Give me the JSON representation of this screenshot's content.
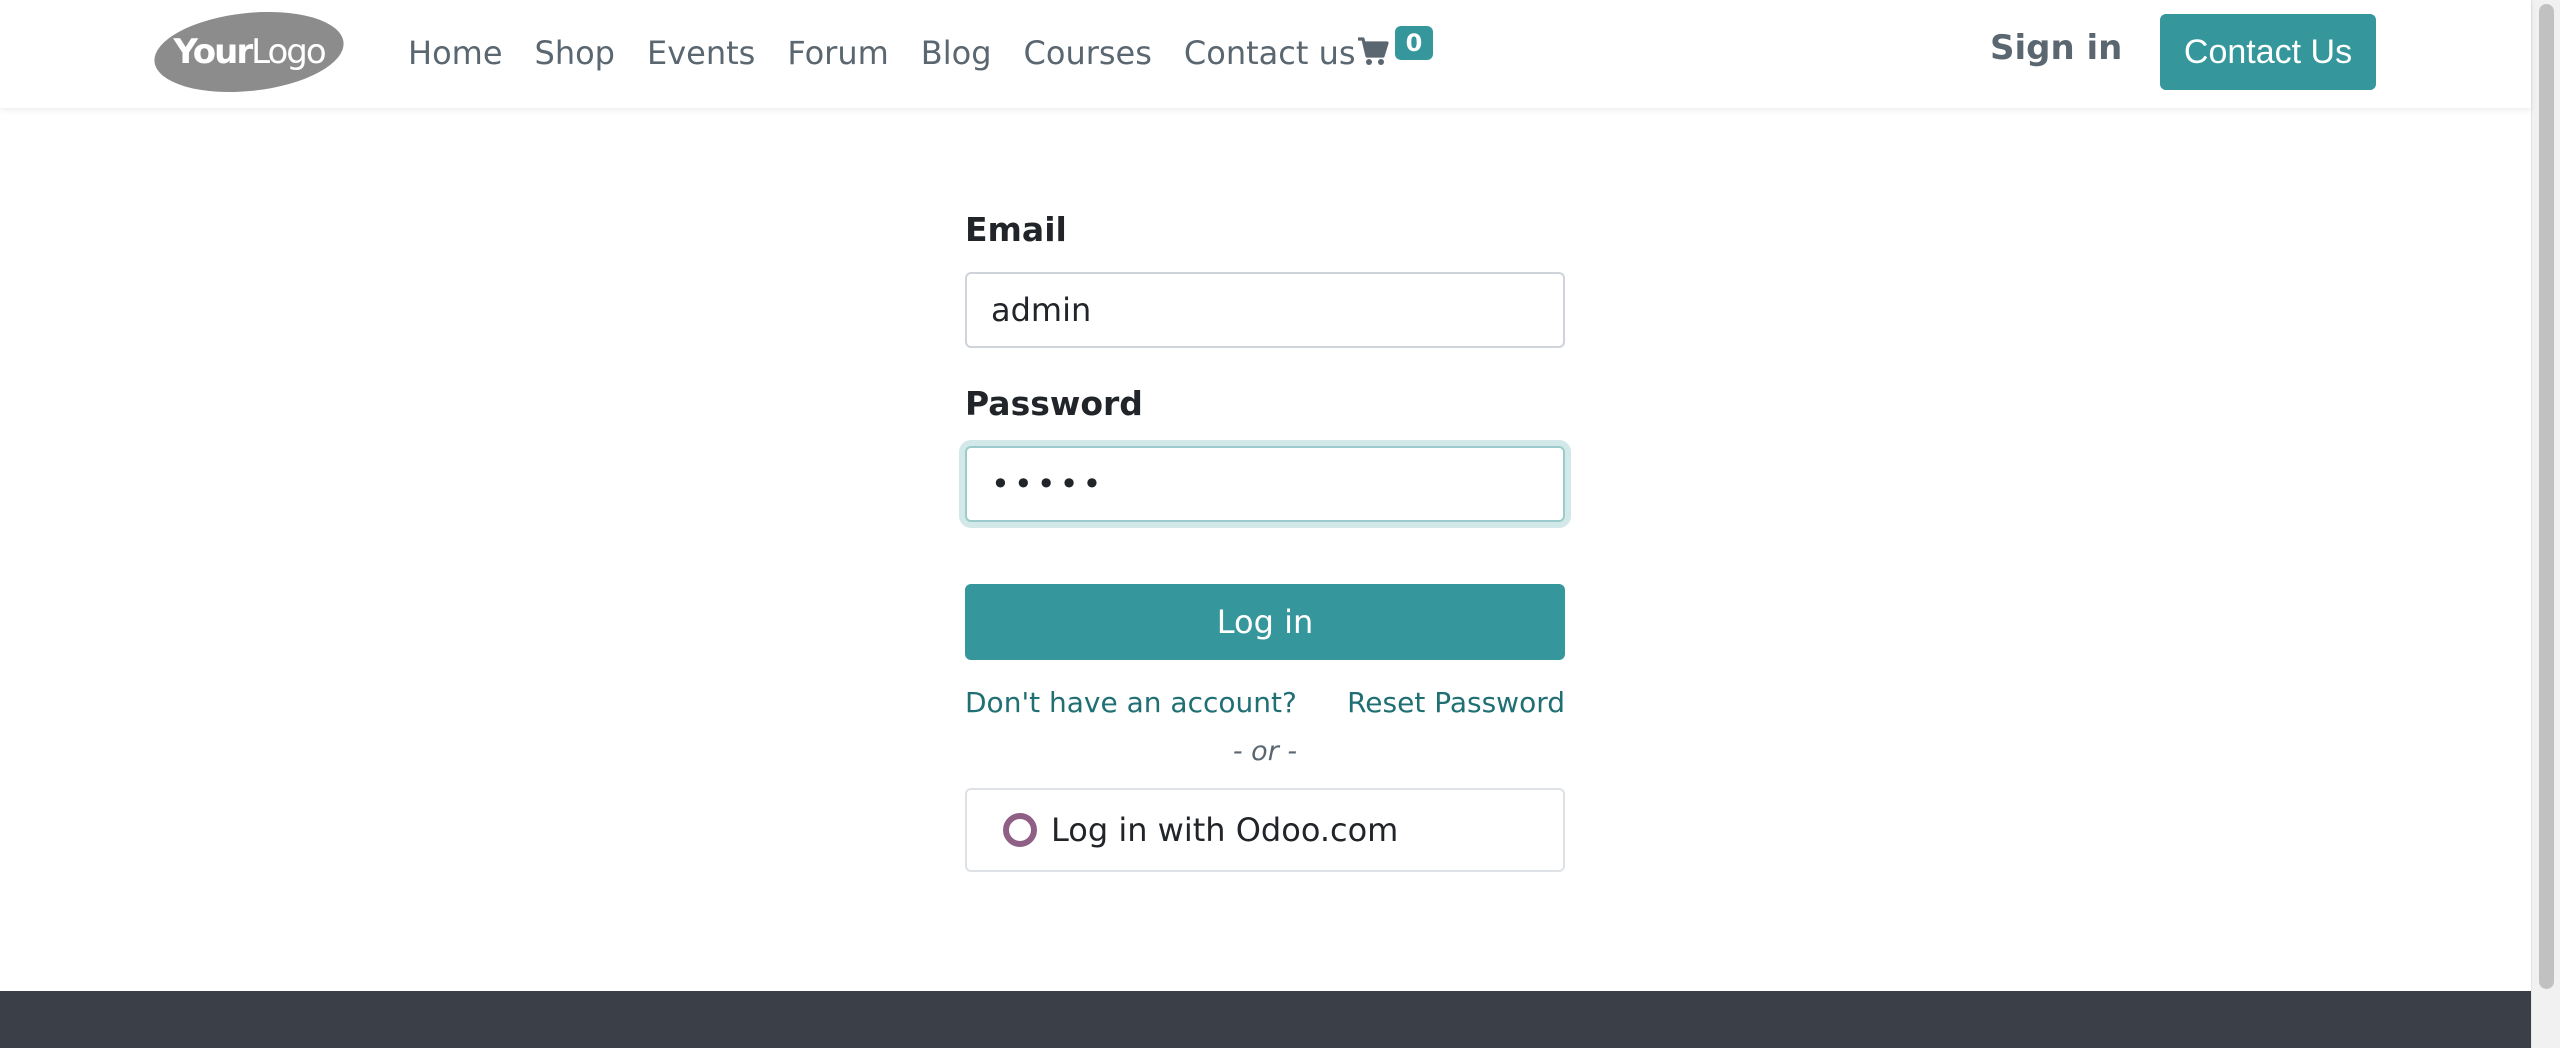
{
  "header": {
    "logo_text": "YourLogo",
    "nav": [
      "Home",
      "Shop",
      "Events",
      "Forum",
      "Blog",
      "Courses",
      "Contact us"
    ],
    "cart_count": "0",
    "sign_in": "Sign in",
    "contact_button": "Contact Us"
  },
  "form": {
    "email_label": "Email",
    "email_value": "admin",
    "password_label": "Password",
    "password_value": "•••••",
    "login_button": "Log in",
    "signup_link": "Don't have an account?",
    "reset_link": "Reset Password",
    "or_text": "- or -",
    "odoo_button": "Log in with Odoo.com"
  },
  "colors": {
    "primary": "#35979c",
    "link": "#1f6f73",
    "footer": "#3b3f47",
    "odoo_ring": "#8f5f86"
  },
  "icons": {
    "cart": "shopping-cart-icon",
    "odoo": "odoo-ring-icon"
  }
}
